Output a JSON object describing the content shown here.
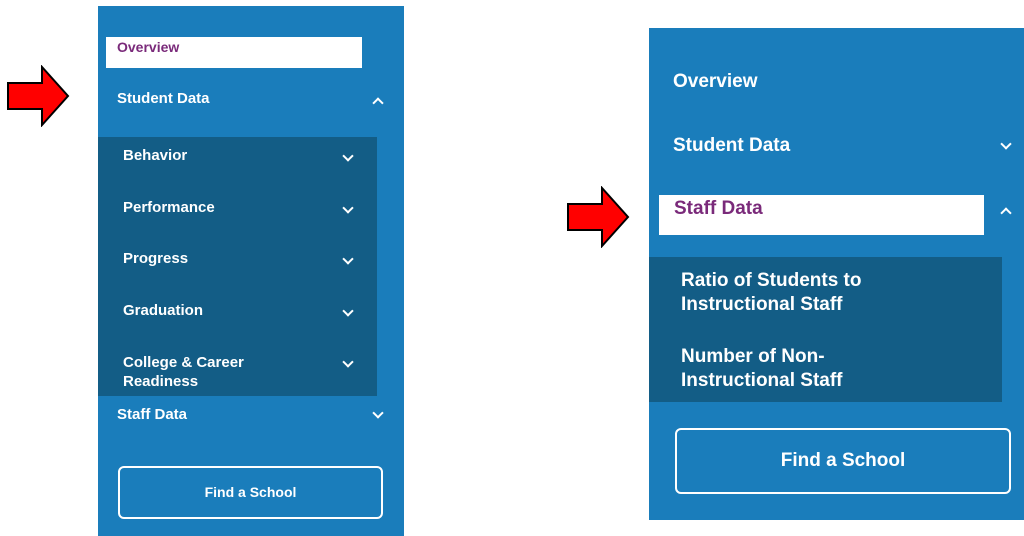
{
  "left_panel": {
    "overview_label": "Overview",
    "student_data_label": "Student Data",
    "submenu": [
      {
        "label": "Behavior"
      },
      {
        "label": "Performance"
      },
      {
        "label": "Progress"
      },
      {
        "label": "Graduation"
      },
      {
        "label": "College & Career Readiness"
      }
    ],
    "staff_data_label": "Staff Data",
    "find_school_label": "Find a School"
  },
  "right_panel": {
    "overview_label": "Overview",
    "student_data_label": "Student Data",
    "staff_data_label": "Staff Data",
    "submenu": [
      {
        "label": "Ratio of Students to Instructional Staff"
      },
      {
        "label": "Number of Non-Instructional Staff"
      }
    ],
    "find_school_label": "Find a School"
  },
  "colors": {
    "panel_bg": "#1a7dbb",
    "submenu_bg": "#135d86",
    "arrow_fill": "#ff0000",
    "selected_text": "#7a2a7a"
  },
  "icons": [
    "arrow-right-icon",
    "chevron-up-icon",
    "chevron-down-icon"
  ]
}
